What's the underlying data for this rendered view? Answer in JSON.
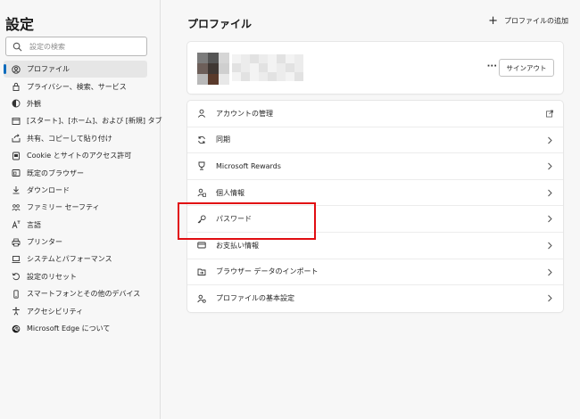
{
  "sidebar": {
    "title": "設定",
    "search": {
      "placeholder": "設定の検索",
      "value": ""
    },
    "items": [
      {
        "label": "プロファイル",
        "icon": "profile-icon",
        "active": true
      },
      {
        "label": "プライバシー、検索、サービス",
        "icon": "lock-icon"
      },
      {
        "label": "外観",
        "icon": "appearance-icon"
      },
      {
        "label": "[スタート]、[ホーム]、および [新規] タブ",
        "icon": "start-tab-icon"
      },
      {
        "label": "共有、コピーして貼り付け",
        "icon": "share-icon"
      },
      {
        "label": "Cookie とサイトのアクセス許可",
        "icon": "cookie-icon"
      },
      {
        "label": "既定のブラウザー",
        "icon": "browser-icon"
      },
      {
        "label": "ダウンロード",
        "icon": "download-icon"
      },
      {
        "label": "ファミリー セーフティ",
        "icon": "family-icon"
      },
      {
        "label": "言語",
        "icon": "language-icon"
      },
      {
        "label": "プリンター",
        "icon": "printer-icon"
      },
      {
        "label": "システムとパフォーマンス",
        "icon": "system-icon"
      },
      {
        "label": "設定のリセット",
        "icon": "reset-icon"
      },
      {
        "label": "スマートフォンとその他のデバイス",
        "icon": "phone-icon"
      },
      {
        "label": "アクセシビリティ",
        "icon": "accessibility-icon"
      },
      {
        "label": "Microsoft Edge について",
        "icon": "edge-logo-icon"
      }
    ]
  },
  "main": {
    "title": "プロファイル",
    "add_profile_label": "プロファイルの追加",
    "signout_label": "サインアウト",
    "more_label": "···",
    "rows": [
      {
        "label": "アカウントの管理",
        "icon": "account-icon",
        "trail": "external-link-icon"
      },
      {
        "label": "同期",
        "icon": "sync-icon",
        "trail": "chevron-right-icon"
      },
      {
        "label": "Microsoft Rewards",
        "icon": "rewards-icon",
        "trail": "chevron-right-icon"
      },
      {
        "label": "個人情報",
        "icon": "personal-info-icon",
        "trail": "chevron-right-icon"
      },
      {
        "label": "パスワード",
        "icon": "key-icon",
        "trail": "chevron-right-icon"
      },
      {
        "label": "お支払い情報",
        "icon": "card-icon",
        "trail": "chevron-right-icon"
      },
      {
        "label": "ブラウザー データのインポート",
        "icon": "import-icon",
        "trail": "chevron-right-icon"
      },
      {
        "label": "プロファイルの基本設定",
        "icon": "profile-settings-icon",
        "trail": "chevron-right-icon"
      }
    ]
  },
  "colors": {
    "accent": "#0f6cbd",
    "highlight": "#e10d12",
    "background": "#f7f7f7",
    "card": "#ffffff"
  }
}
